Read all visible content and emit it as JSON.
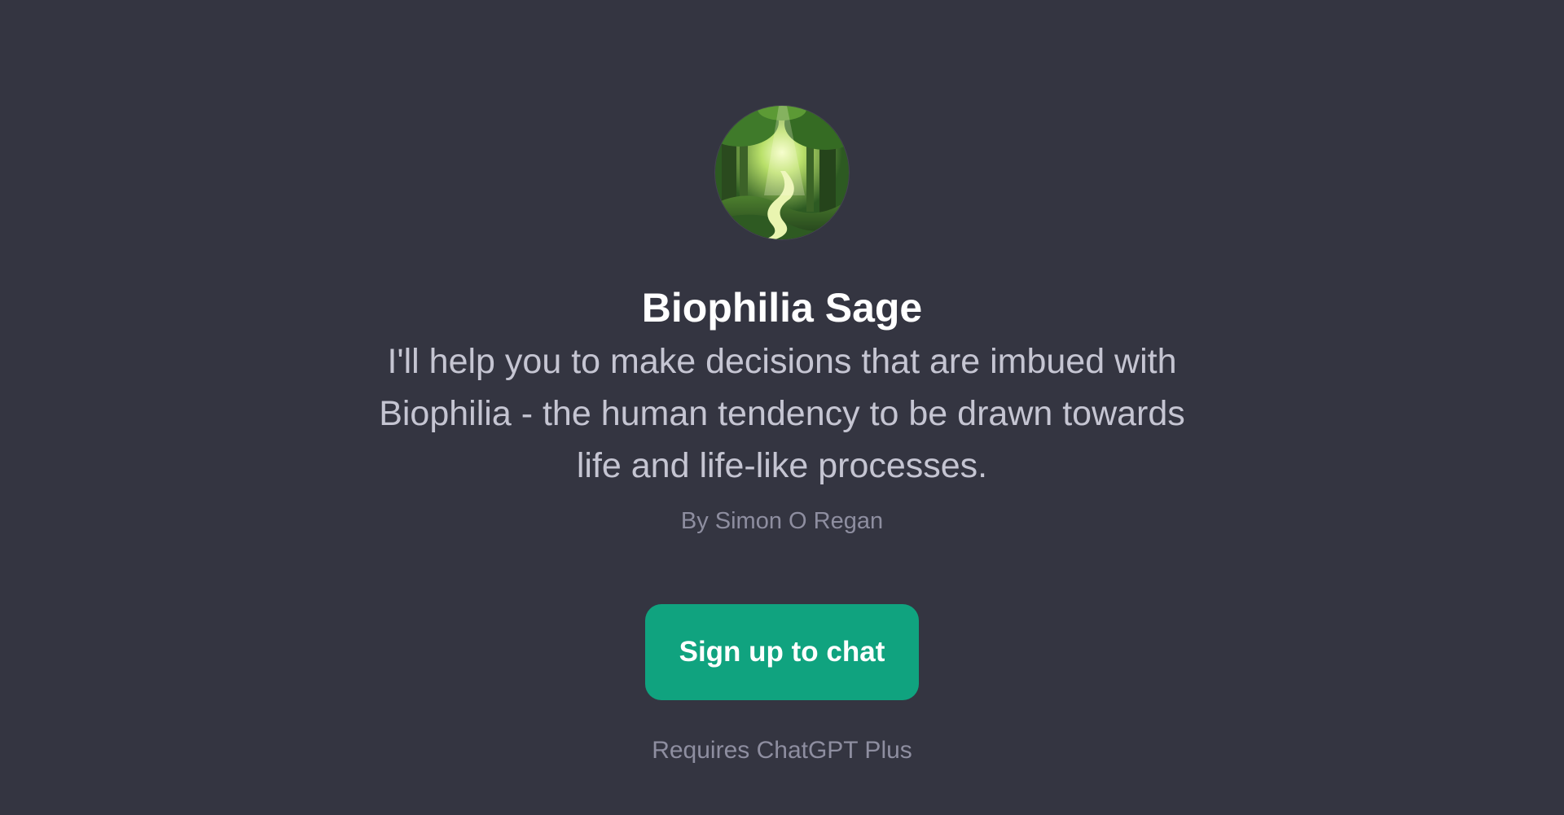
{
  "gpt": {
    "avatar_icon": "forest-path-avatar",
    "name": "Biophilia Sage",
    "description": "I'll help you to make decisions that are imbued with Biophilia - the human tendency to be drawn towards life and life-like processes.",
    "author": "By Simon O Regan"
  },
  "cta": {
    "signup_label": "Sign up to chat",
    "requirement": "Requires ChatGPT Plus"
  },
  "colors": {
    "background": "#343541",
    "accent": "#10a37f",
    "title": "#ffffff",
    "text": "#c5c5d2",
    "muted": "#8e8ea0"
  }
}
